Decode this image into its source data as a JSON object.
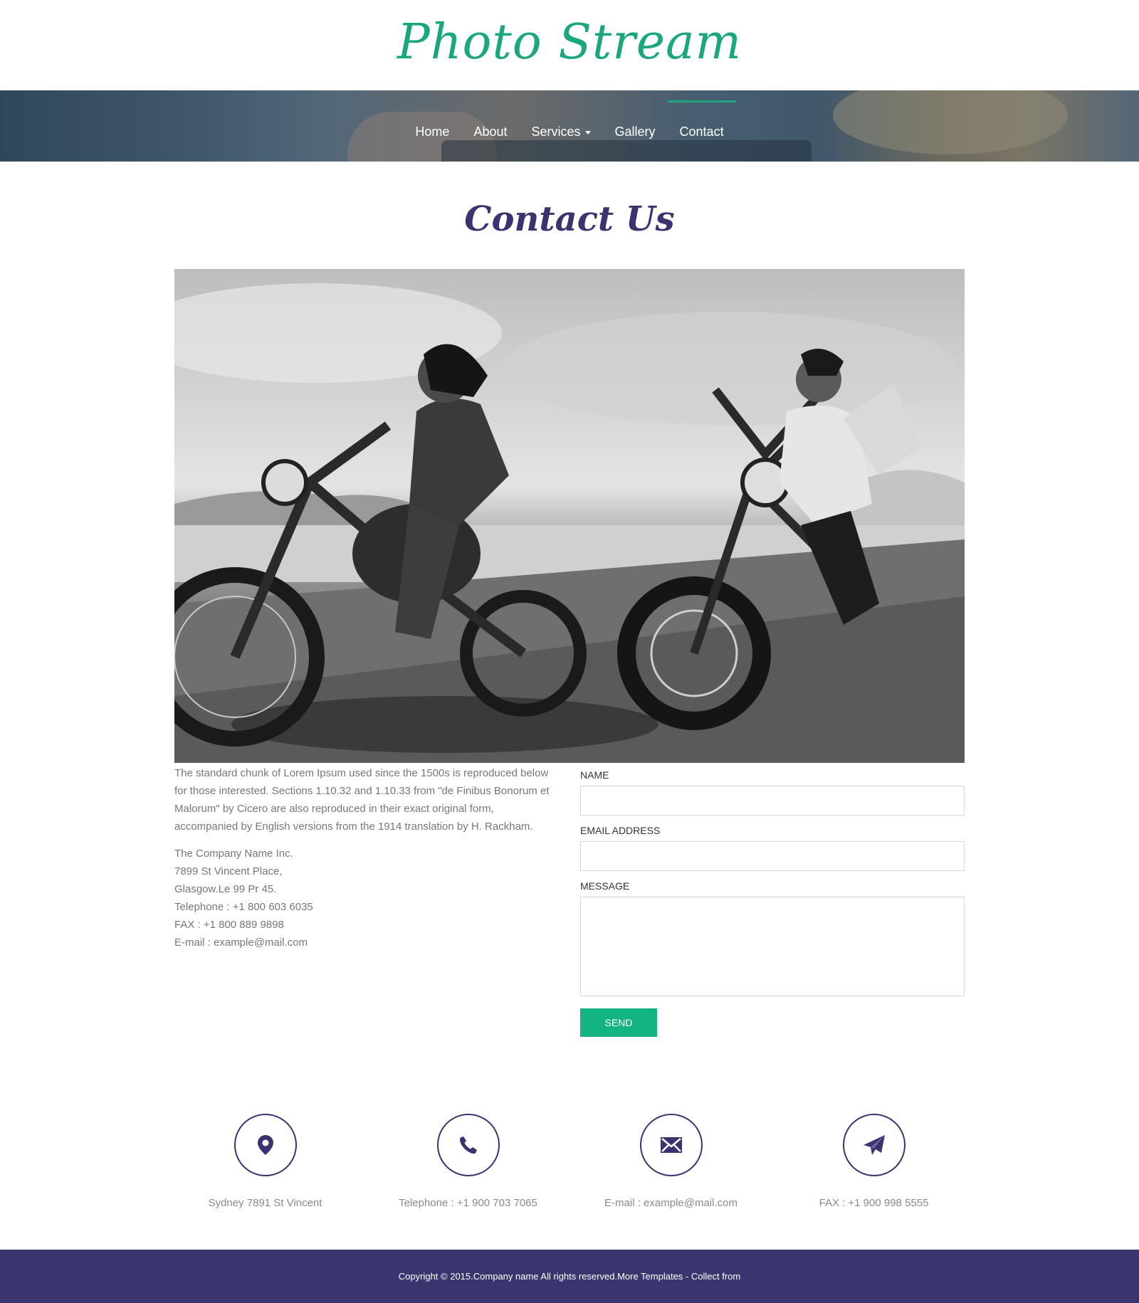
{
  "brand": {
    "logo_text": "Photo Stream"
  },
  "nav": {
    "items": [
      {
        "label": "Home"
      },
      {
        "label": "About"
      },
      {
        "label": "Services"
      },
      {
        "label": "Gallery"
      },
      {
        "label": "Contact"
      }
    ],
    "active": "Contact"
  },
  "page": {
    "title": "Contact Us"
  },
  "about_text": "The standard chunk of Lorem Ipsum used since the 1500s is reproduced below for those interested. Sections 1.10.32 and 1.10.33 from \"de Finibus Bonorum et Malorum\" by Cicero are also reproduced in their exact original form, accompanied by English versions from the 1914 translation by H. Rackham.",
  "address": {
    "company": "The Company Name Inc.",
    "street": "7899 St Vincent Place,",
    "city": "Glasgow.Le 99 Pr 45.",
    "telephone": "Telephone : +1 800 603 6035",
    "fax": "FAX : +1 800 889 9898",
    "email": "E-mail : example@mail.com"
  },
  "form": {
    "name_label": "NAME",
    "email_label": "EMAIL ADDRESS",
    "message_label": "MESSAGE",
    "send_label": "SEND"
  },
  "info": [
    {
      "icon": "map-marker-icon",
      "text": "Sydney 7891 St Vincent"
    },
    {
      "icon": "phone-icon",
      "text": "Telephone : +1 900 703 7065"
    },
    {
      "icon": "envelope-icon",
      "text": "E-mail : example@mail.com"
    },
    {
      "icon": "paper-plane-icon",
      "text": "FAX : +1 900 998 5555"
    }
  ],
  "footer": {
    "text": "Copyright © 2015.Company name All rights reserved.More Templates    - Collect from"
  },
  "colors": {
    "accent_green": "#13b383",
    "logo_green": "#1aa67f",
    "brand_purple": "#3a3370",
    "footer_bg": "#3b356f"
  }
}
